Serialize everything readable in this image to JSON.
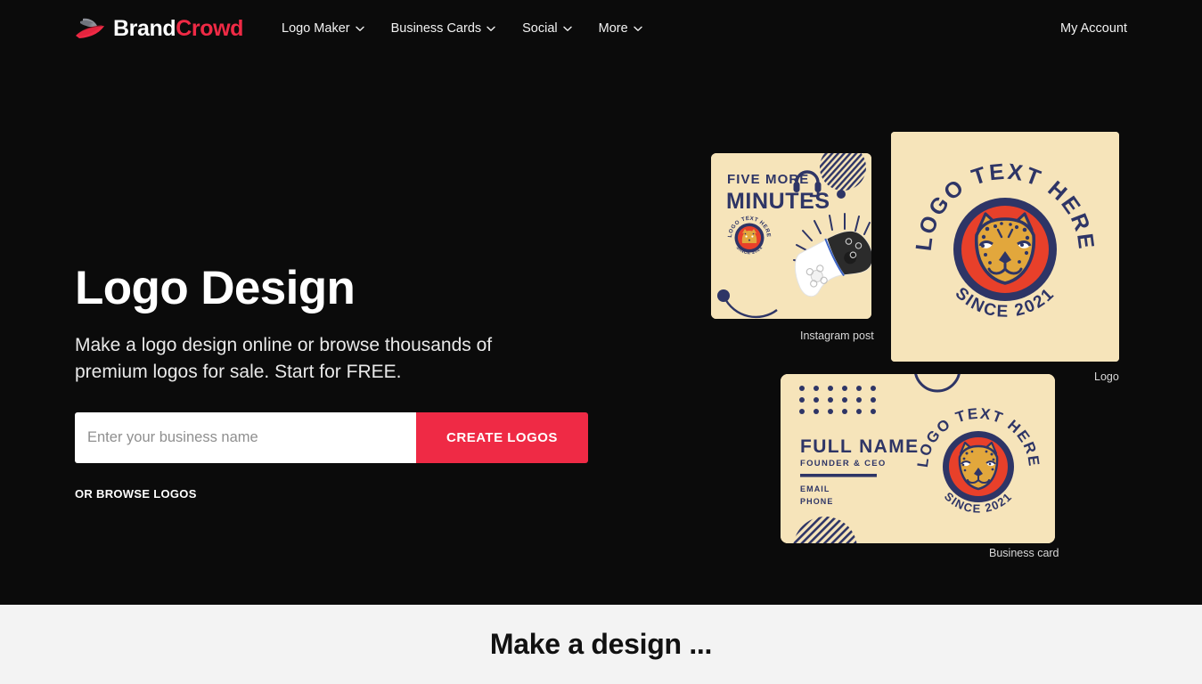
{
  "header": {
    "brand": {
      "word1": "Brand",
      "word2": "Crowd",
      "logo_icon": "brandcrowd-feather-icon"
    },
    "nav": [
      {
        "label": "Logo Maker",
        "icon": "chevron-down-icon"
      },
      {
        "label": "Business Cards",
        "icon": "chevron-down-icon"
      },
      {
        "label": "Social",
        "icon": "chevron-down-icon"
      },
      {
        "label": "More",
        "icon": "chevron-down-icon"
      }
    ],
    "account_label": "My Account"
  },
  "hero": {
    "title": "Logo Design",
    "subtitle": "Make a logo design online or browse thousands of premium logos for sale. Start for FREE.",
    "search_placeholder": "Enter your business name",
    "search_value": "",
    "cta_label": "CREATE LOGOS",
    "browse_label": "OR BROWSE LOGOS"
  },
  "showcase": {
    "instagram_card": {
      "caption": "Instagram post",
      "headline_line1": "FIVE MORE",
      "headline_line2": "MINUTES",
      "icons": [
        "headset-icon",
        "striped-circle-decoration",
        "dot-decoration",
        "game-controller-illustration",
        "sunburst-decoration"
      ],
      "badge": {
        "arc_top": "LOGO TEXT HERE",
        "arc_bottom": "SINCE 2021"
      }
    },
    "logo_card": {
      "caption": "Logo",
      "arc_top": "LOGO TEXT HERE",
      "arc_bottom": "SINCE 2021",
      "mascot": "cheetah-head-mascot-icon"
    },
    "business_card": {
      "caption": "Business card",
      "full_name": "FULL NAME",
      "role": "FOUNDER & CEO",
      "email_label": "EMAIL",
      "phone_label": "PHONE",
      "badge": {
        "arc_top": "LOGO TEXT HERE",
        "arc_bottom": "SINCE 2021"
      }
    }
  },
  "band": {
    "title": "Make a design ..."
  },
  "colors": {
    "background": "#0b0b0b",
    "accent_red": "#ef2a45",
    "cream": "#f6e4ba",
    "navy": "#2e3566",
    "gold": "#e2a73c",
    "orange_red": "#e8402a",
    "band_bg": "#f3f3f3"
  }
}
